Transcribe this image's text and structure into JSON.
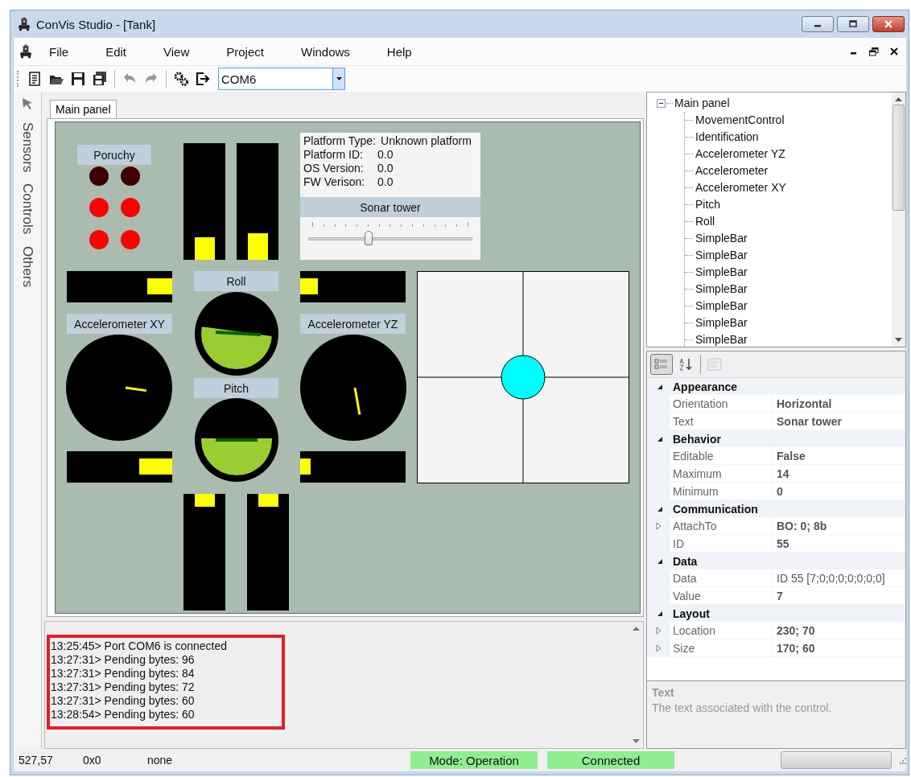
{
  "window": {
    "title": "ConVis Studio - [Tank]"
  },
  "menu": [
    "File",
    "Edit",
    "View",
    "Project",
    "Windows",
    "Help"
  ],
  "toolbar": {
    "buttons": [
      {
        "disabled": false
      },
      {
        "disabled": false
      },
      {
        "disabled": false
      },
      {
        "disabled": false
      },
      {
        "disabled": true
      },
      {
        "disabled": true
      },
      {
        "disabled": false
      },
      {
        "disabled": false
      }
    ],
    "port": "COM6"
  },
  "side_tabs": [
    "Sensors",
    "Controls",
    "Others"
  ],
  "document_tabs": [
    {
      "label": "Main panel",
      "selected": true
    }
  ],
  "canvas": {
    "faults": {
      "title": "Poruchy",
      "leds": [
        {
          "on": false
        },
        {
          "on": false
        },
        {
          "on": true
        },
        {
          "on": true
        },
        {
          "on": true
        },
        {
          "on": true
        }
      ]
    },
    "bars": [
      {
        "level": 0.19
      },
      {
        "level": 0.23
      },
      {
        "level": 0.24
      },
      {
        "level": 0.17
      },
      {
        "level": 0.31
      },
      {
        "level": 0.1
      },
      {
        "level": 0.11
      },
      {
        "level": 0.11
      }
    ],
    "info": {
      "lines": [
        {
          "label": "Platform Type:",
          "value": "Unknown platform"
        },
        {
          "label": "Platform ID:",
          "value": "0.0"
        },
        {
          "label": "OS Version:",
          "value": "0.0"
        },
        {
          "label": "FW Verison:",
          "value": "0.0"
        }
      ],
      "slider": {
        "title": "Sonar tower",
        "level": 0.36
      }
    },
    "gauges": [
      {
        "kind": "horizon",
        "title": "Roll"
      },
      {
        "kind": "dial",
        "title": "Accelerometer XY"
      },
      {
        "kind": "horizon",
        "title": "Pitch"
      },
      {
        "kind": "dial",
        "title": "Accelerometer YZ"
      }
    ]
  },
  "log": [
    "13:25:45> Port COM6 is connected",
    "13:27:31> Pending bytes: 96",
    "13:27:31> Pending bytes: 84",
    "13:27:31> Pending bytes: 72",
    "13:27:31> Pending bytes: 60",
    "13:28:54> Pending bytes: 60"
  ],
  "tree": {
    "label": "Main panel",
    "expanded": true,
    "children": [
      {
        "label": "MovementControl"
      },
      {
        "label": "Identification"
      },
      {
        "label": "Accelerometer YZ"
      },
      {
        "label": "Accelerometer"
      },
      {
        "label": "Accelerometer XY"
      },
      {
        "label": "Pitch"
      },
      {
        "label": "Roll"
      },
      {
        "label": "SimpleBar"
      },
      {
        "label": "SimpleBar"
      },
      {
        "label": "SimpleBar"
      },
      {
        "label": "SimpleBar"
      },
      {
        "label": "SimpleBar"
      },
      {
        "label": "SimpleBar"
      },
      {
        "label": "SimpleBar"
      }
    ]
  },
  "properties": {
    "view_buttons": [
      {
        "selected": true,
        "disabled": false
      },
      {
        "selected": false,
        "disabled": false
      },
      {
        "selected": false,
        "disabled": true
      }
    ],
    "categories": [
      {
        "name": "Appearance",
        "expanded": true,
        "rows": [
          {
            "name": "Orientation",
            "value": "Horizontal",
            "expandable": false,
            "modified": true
          },
          {
            "name": "Text",
            "value": "Sonar tower",
            "expandable": false,
            "modified": true
          }
        ]
      },
      {
        "name": "Behavior",
        "expanded": true,
        "rows": [
          {
            "name": "Editable",
            "value": "False",
            "expandable": false,
            "modified": true
          },
          {
            "name": "Maximum",
            "value": "14",
            "expandable": false,
            "modified": true
          },
          {
            "name": "Minimum",
            "value": "0",
            "expandable": false,
            "modified": true
          }
        ]
      },
      {
        "name": "Communication",
        "expanded": true,
        "rows": [
          {
            "name": "AttachTo",
            "value": "BO: 0; 8b",
            "expandable": true,
            "modified": true
          },
          {
            "name": "ID",
            "value": "55",
            "expandable": false,
            "modified": true
          }
        ]
      },
      {
        "name": "Data",
        "expanded": true,
        "rows": [
          {
            "name": "Data",
            "value": "ID 55 [7;0;0;0;0;0;0;0]",
            "expandable": false,
            "modified": false
          },
          {
            "name": "Value",
            "value": "7",
            "expandable": false,
            "modified": true
          }
        ]
      },
      {
        "name": "Layout",
        "expanded": true,
        "rows": [
          {
            "name": "Location",
            "value": "230; 70",
            "expandable": true,
            "modified": true
          },
          {
            "name": "Size",
            "value": "170; 60",
            "expandable": true,
            "modified": true
          }
        ]
      }
    ],
    "description": {
      "title": "Text",
      "text": "The text associated with the control."
    }
  },
  "status_bar": {
    "fields": [
      "527,57",
      "0x0",
      "none"
    ],
    "badges": [
      "Mode: Operation",
      "Connected"
    ],
    "progress": {
      "level": 0
    }
  }
}
